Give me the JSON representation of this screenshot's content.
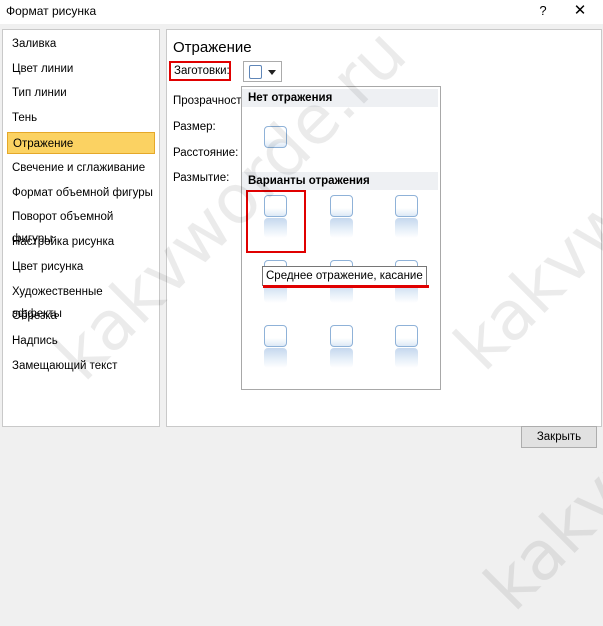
{
  "window": {
    "title": "Формат рисунка",
    "help": "?",
    "close": "✕"
  },
  "sidebar": {
    "items": [
      {
        "label": "Заливка"
      },
      {
        "label": "Цвет линии"
      },
      {
        "label": "Тип линии"
      },
      {
        "label": "Тень"
      },
      {
        "label": "Отражение"
      },
      {
        "label": "Свечение и сглаживание"
      },
      {
        "label": "Формат объемной фигуры"
      },
      {
        "label": "Поворот объемной фигуры"
      },
      {
        "label": "Настройка рисунка"
      },
      {
        "label": "Цвет рисунка"
      },
      {
        "label": "Художественные эффекты"
      },
      {
        "label": "Обрезка"
      },
      {
        "label": "Надпись"
      },
      {
        "label": "Замещающий текст"
      }
    ],
    "active": "Отражение"
  },
  "panel": {
    "title": "Отражение",
    "presets_label": "Заготовки:",
    "transparency_label": "Прозрачность",
    "size_label": "Размер:",
    "distance_label": "Расстояние:",
    "blur_label": "Размытие:"
  },
  "gallery": {
    "no_reflection_header": "Нет отражения",
    "variants_header": "Варианты отражения",
    "tooltip": "Среднее отражение, касание"
  },
  "footer": {
    "close_label": "Закрыть"
  },
  "watermark": "kakvworde.ru",
  "colors": {
    "highlight": "#fbd262",
    "annotation_red": "#e00000"
  }
}
